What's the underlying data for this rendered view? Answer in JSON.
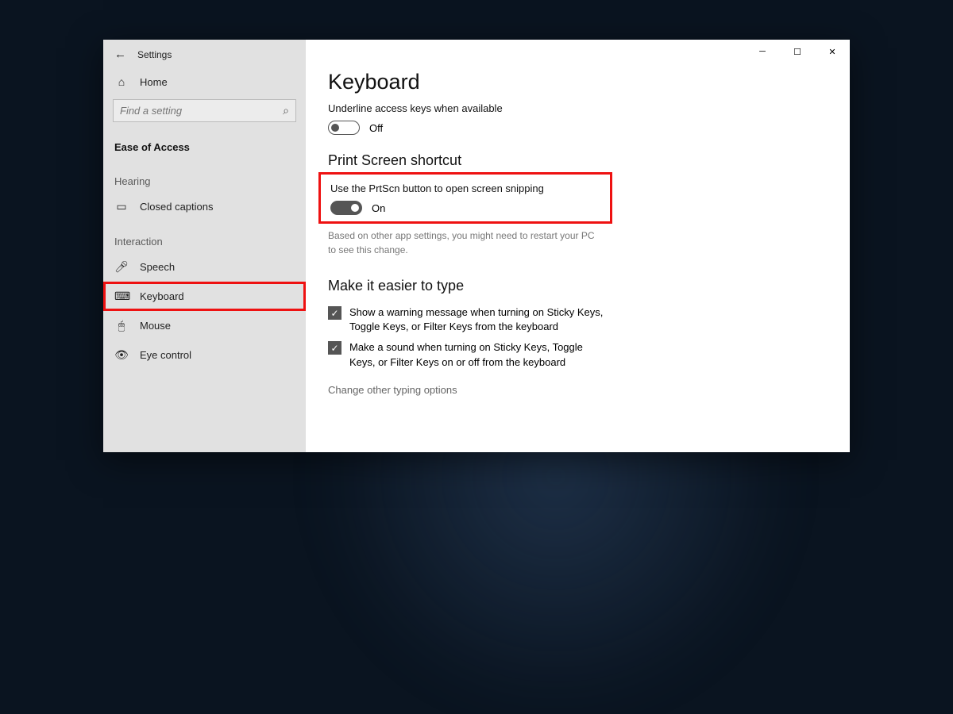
{
  "window": {
    "title": "Settings"
  },
  "sidebar": {
    "home": "Home",
    "search_placeholder": "Find a setting",
    "category": "Ease of Access",
    "groups": {
      "hearing": {
        "label": "Hearing",
        "items": [
          {
            "icon": "cc-icon",
            "label": "Closed captions"
          }
        ]
      },
      "interaction": {
        "label": "Interaction",
        "items": [
          {
            "icon": "microphone-icon",
            "label": "Speech"
          },
          {
            "icon": "keyboard-icon",
            "label": "Keyboard",
            "selected": true
          },
          {
            "icon": "mouse-icon",
            "label": "Mouse"
          },
          {
            "icon": "eye-icon",
            "label": "Eye control"
          }
        ]
      }
    }
  },
  "content": {
    "heading": "Keyboard",
    "underline": {
      "label": "Underline access keys when available",
      "state": "Off"
    },
    "prtscn": {
      "heading": "Print Screen shortcut",
      "label": "Use the PrtScn button to open screen snipping",
      "state": "On",
      "hint": "Based on other app settings, you might need to restart your PC to see this change."
    },
    "typing": {
      "heading": "Make it easier to type",
      "check1": "Show a warning message when turning on Sticky Keys, Toggle Keys, or Filter Keys from the keyboard",
      "check2": "Make a sound when turning on Sticky Keys, Toggle Keys, or Filter Keys on or off from the keyboard",
      "link": "Change other typing options"
    }
  }
}
